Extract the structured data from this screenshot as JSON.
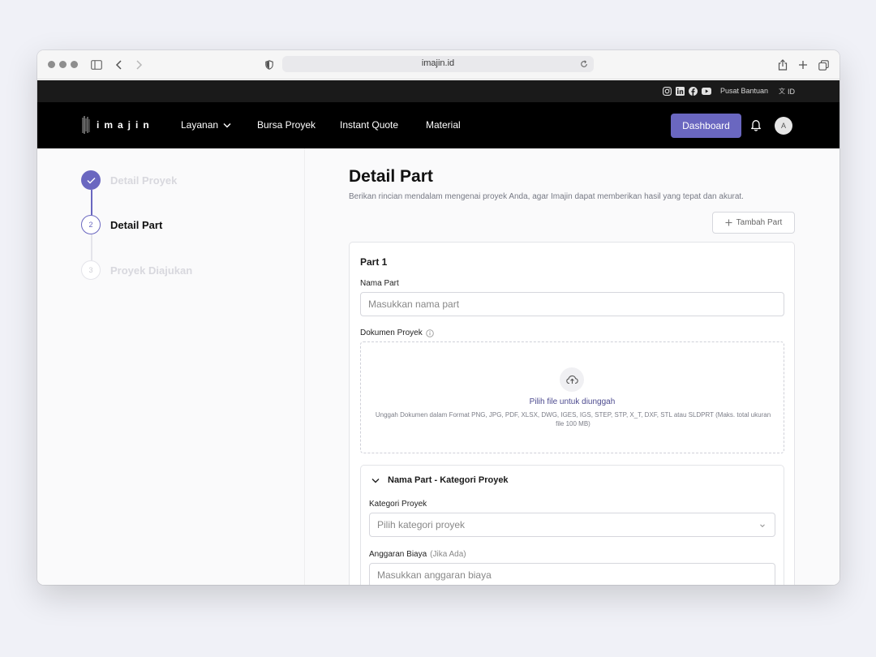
{
  "browser": {
    "url": "imajin.id"
  },
  "topbar": {
    "help": "Pusat Bantuan",
    "lang": "ID"
  },
  "nav": {
    "logo": "imajin",
    "items": [
      {
        "label": "Layanan"
      },
      {
        "label": "Bursa Proyek"
      },
      {
        "label": "Instant Quote"
      },
      {
        "label": "Material"
      }
    ],
    "dashboard": "Dashboard",
    "avatar": "A"
  },
  "steps": [
    {
      "number": "1",
      "label": "Detail Proyek",
      "state": "done"
    },
    {
      "number": "2",
      "label": "Detail Part",
      "state": "active"
    },
    {
      "number": "3",
      "label": "Proyek Diajukan",
      "state": "pending"
    }
  ],
  "page": {
    "title": "Detail Part",
    "subtitle": "Berikan rincian mendalam mengenai proyek Anda, agar Imajin dapat memberikan hasil yang tepat dan akurat.",
    "add_part": "Tambah Part"
  },
  "part": {
    "title": "Part 1",
    "name_label": "Nama Part",
    "name_placeholder": "Masukkan nama part",
    "doc_label": "Dokumen Proyek",
    "upload_title": "Pilih file untuk diunggah",
    "upload_hint": "Unggah Dokumen dalam Format PNG, JPG, PDF, XLSX, DWG, IGES, IGS, STEP, STP, X_T, DXF, STL atau SLDPRT (Maks. total ukuran file 100 MB)",
    "section_title": "Nama Part - Kategori Proyek",
    "category_label": "Kategori Proyek",
    "category_placeholder": "Pilih kategori proyek",
    "budget_label": "Anggaran Biaya",
    "budget_optional": "(Jika Ada)",
    "budget_placeholder": "Masukkan anggaran biaya"
  },
  "colors": {
    "accent": "#6a67c0",
    "nav_bg": "#000000",
    "topbar_bg": "#1a1a1a"
  }
}
